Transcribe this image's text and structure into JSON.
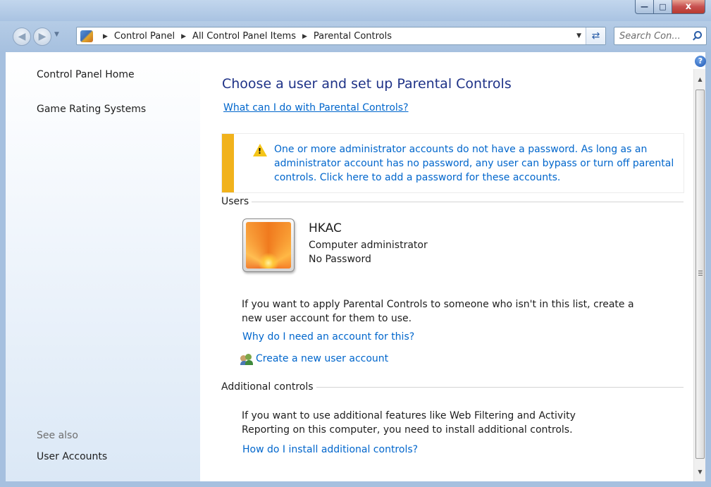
{
  "window": {
    "minimize_label": "—",
    "maximize_label": "□",
    "close_label": "x"
  },
  "nav": {
    "back_icon": "back-arrow-icon",
    "forward_icon": "forward-arrow-icon",
    "breadcrumbs": [
      "Control Panel",
      "All Control Panel Items",
      "Parental Controls"
    ],
    "search_placeholder": "Search Con...",
    "refresh_icon": "refresh-icon"
  },
  "sidebar": {
    "items": [
      {
        "label": "Control Panel Home"
      },
      {
        "label": "Game Rating Systems"
      }
    ],
    "see_also_label": "See also",
    "see_also_items": [
      {
        "label": "User Accounts"
      }
    ]
  },
  "main": {
    "title": "Choose a user and set up Parental Controls",
    "help_link": "What can I do with Parental Controls?",
    "warning": "One or more administrator accounts do not have a password. As long as an administrator account has no password, any user can bypass or turn off parental controls. Click here to add a password for these accounts.",
    "users_heading": "Users",
    "user": {
      "name": "HKAC",
      "role": "Computer administrator",
      "password_status": "No Password"
    },
    "create_info": "If you want to apply Parental Controls to someone who isn't in this list, create a new user account for them to use.",
    "why_link": "Why do I need an account for this?",
    "create_link": "Create a new user account",
    "additional_heading": "Additional controls",
    "additional_info": "If you want to use additional features like Web Filtering and Activity Reporting on this computer, you need to install additional controls.",
    "install_link": "How do I install additional controls?"
  },
  "colors": {
    "link": "#0066cc",
    "title": "#1e3287",
    "warning_bar": "#f1b21c"
  }
}
